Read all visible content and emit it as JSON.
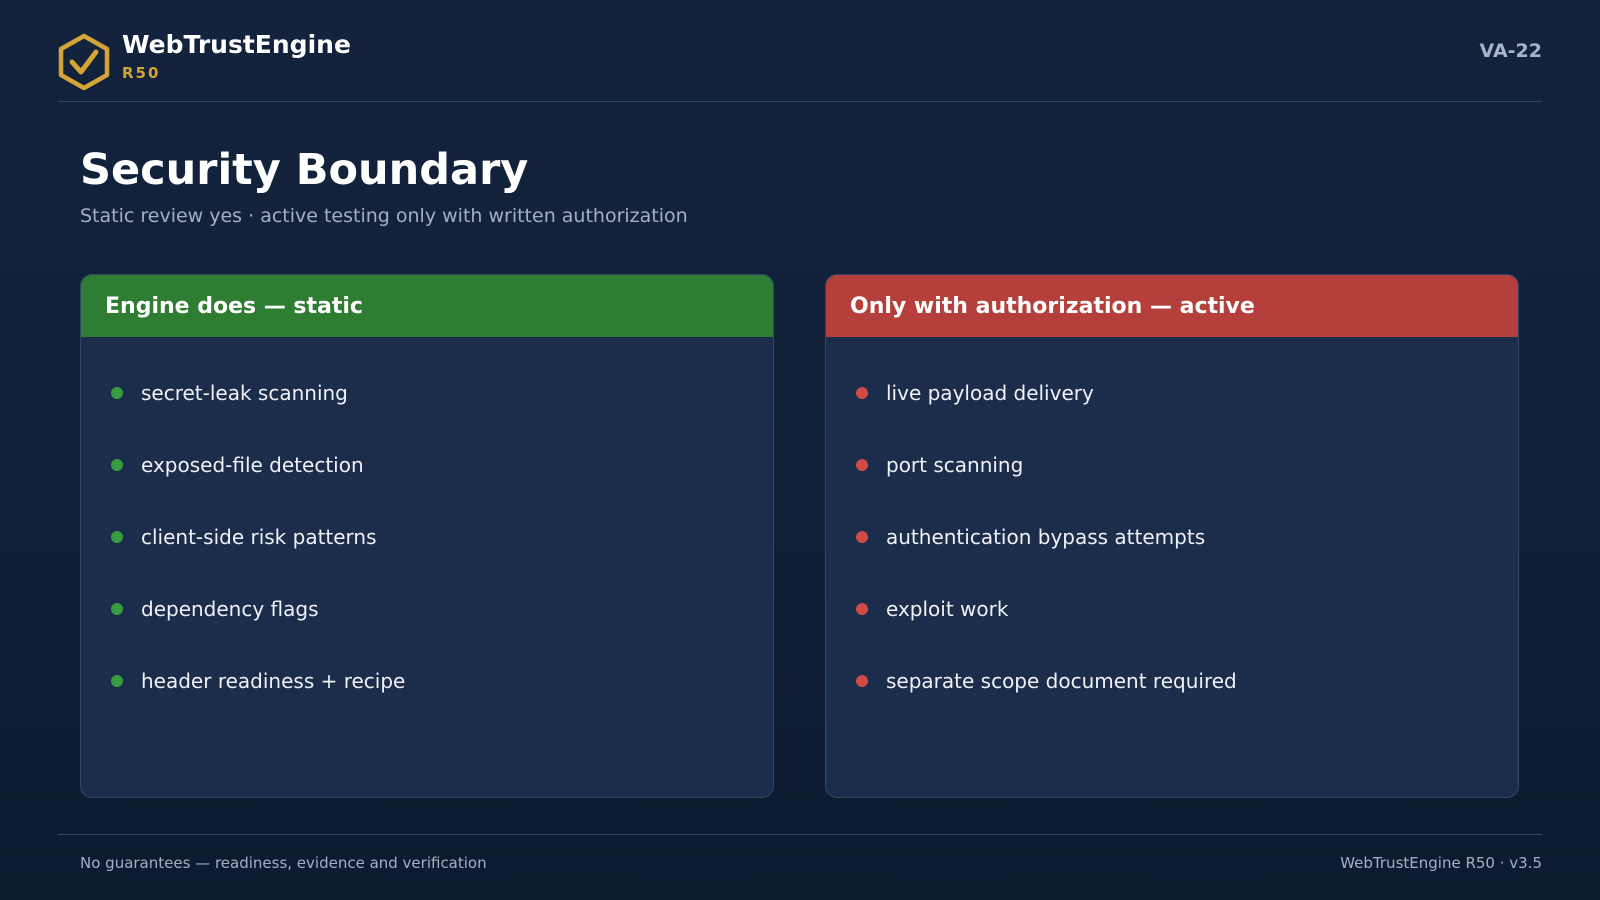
{
  "header": {
    "brand_name": "WebTrustEngine",
    "brand_version": "R50",
    "doc_id": "VA-22",
    "logo_icon": "shield-check-icon"
  },
  "page": {
    "title": "Security Boundary",
    "subtitle": "Static review yes · active testing only with written authorization"
  },
  "panels": {
    "static": {
      "title": "Engine does — static",
      "accent": "#2e7d32",
      "items": [
        "secret-leak scanning",
        "exposed-file detection",
        "client-side risk patterns",
        "dependency flags",
        "header readiness + recipe"
      ]
    },
    "active": {
      "title": "Only with authorization — active",
      "accent": "#b5403b",
      "items": [
        "live payload delivery",
        "port scanning",
        "authentication bypass attempts",
        "exploit work",
        "separate scope document required"
      ]
    }
  },
  "footer": {
    "left": "No guarantees — readiness, evidence and verification",
    "right": "WebTrustEngine R50 · v3.5"
  },
  "colors": {
    "background": "#122139",
    "brand_gold": "#d4a437",
    "static_green": "#2e7d32",
    "active_red": "#b5403b"
  }
}
